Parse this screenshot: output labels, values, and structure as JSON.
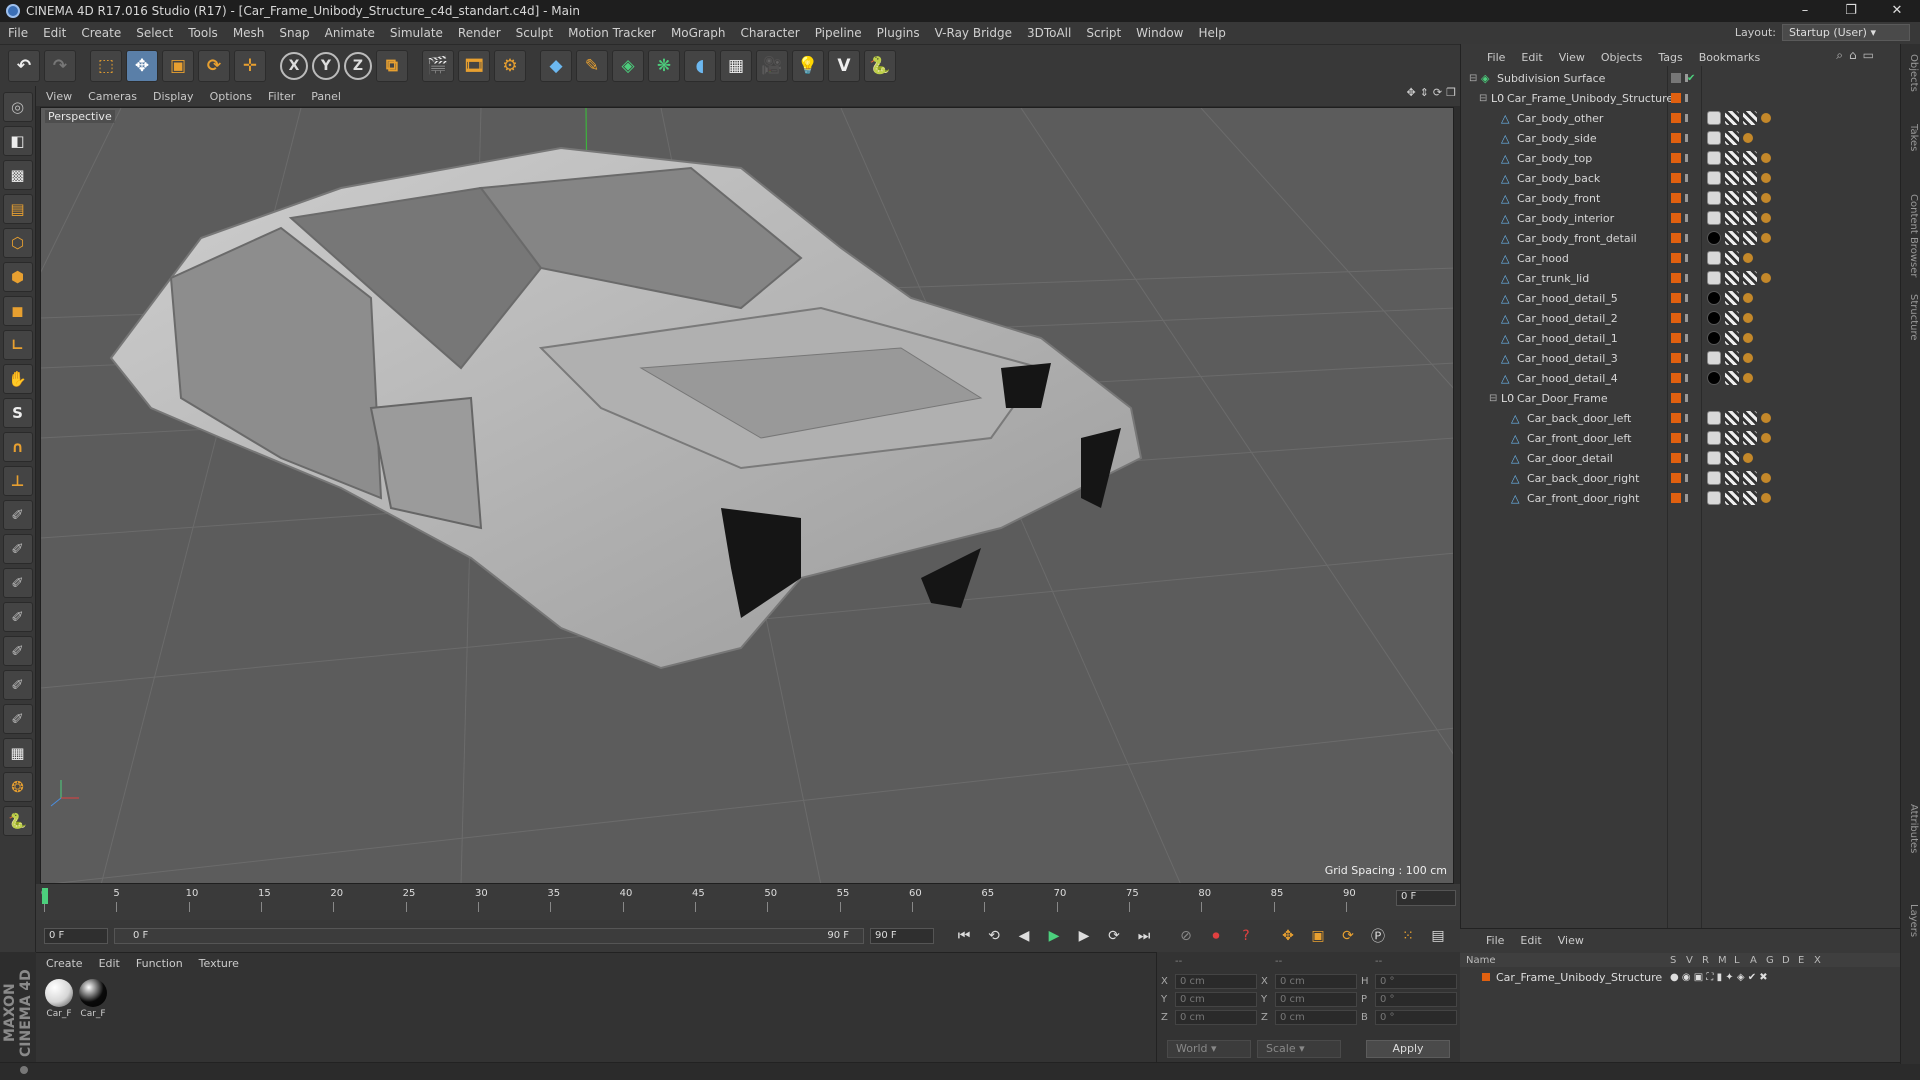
{
  "window": {
    "title": "CINEMA 4D R17.016 Studio (R17) - [Car_Frame_Unibody_Structure_c4d_standart.c4d] - Main",
    "controls": [
      "–",
      "❐",
      "✕"
    ]
  },
  "menubar": {
    "items": [
      "File",
      "Edit",
      "Create",
      "Select",
      "Tools",
      "Mesh",
      "Snap",
      "Animate",
      "Simulate",
      "Render",
      "Sculpt",
      "Motion Tracker",
      "MoGraph",
      "Character",
      "Pipeline",
      "Plugins",
      "V-Ray Bridge",
      "3DToAll",
      "Script",
      "Window",
      "Help"
    ],
    "layout_label": "Layout:",
    "layout_value": "Startup (User)"
  },
  "toolbar": {
    "axis_x": "X",
    "axis_y": "Y",
    "axis_z": "Z"
  },
  "viewport": {
    "menu": [
      "View",
      "Cameras",
      "Display",
      "Options",
      "Filter",
      "Panel"
    ],
    "label": "Perspective",
    "grid_spacing": "Grid Spacing : 100 cm",
    "colors": {
      "background": "#5c5c5c",
      "grid": "#6a6a6a",
      "model": "#b8b8b8"
    }
  },
  "timeline": {
    "ticks": [
      "0",
      "5",
      "10",
      "15",
      "20",
      "25",
      "30",
      "35",
      "40",
      "45",
      "50",
      "55",
      "60",
      "65",
      "70",
      "75",
      "80",
      "85",
      "90"
    ],
    "current_frame": "0 F"
  },
  "transport": {
    "start_field": "0 F",
    "slider_start": "0 F",
    "slider_end": "90 F",
    "end_field": "90 F"
  },
  "material_manager": {
    "menu": [
      "Create",
      "Edit",
      "Function",
      "Texture"
    ],
    "materials": [
      {
        "label": "Car_F",
        "color": "#d6d6d6"
      },
      {
        "label": "Car_F",
        "color": "#0a0a0a"
      }
    ]
  },
  "coordinates": {
    "headers": [
      "--",
      "--",
      "--"
    ],
    "rows": [
      {
        "a": "X",
        "v1": "0 cm",
        "b": "X",
        "v2": "0 cm",
        "c": "H",
        "v3": "0 °"
      },
      {
        "a": "Y",
        "v1": "0 cm",
        "b": "Y",
        "v2": "0 cm",
        "c": "P",
        "v3": "0 °"
      },
      {
        "a": "Z",
        "v1": "0 cm",
        "b": "Z",
        "v2": "0 cm",
        "c": "B",
        "v3": "0 °"
      }
    ],
    "world": "World",
    "scale": "Scale",
    "apply": "Apply"
  },
  "object_manager": {
    "menu": [
      "File",
      "Edit",
      "View",
      "Objects",
      "Tags",
      "Bookmarks"
    ],
    "objects": [
      {
        "name": "Subdivision Surface",
        "indent": 0,
        "icon": "subdiv-icon",
        "tags": []
      },
      {
        "name": "Car_Frame_Unibody_Structure",
        "indent": 1,
        "icon": "null-icon",
        "tags": []
      },
      {
        "name": "Car_body_other",
        "indent": 2,
        "icon": "poly-icon",
        "tags": [
          "phong",
          "check",
          "check",
          "ext"
        ]
      },
      {
        "name": "Car_body_side",
        "indent": 2,
        "icon": "poly-icon",
        "tags": [
          "phong",
          "check",
          "ext"
        ]
      },
      {
        "name": "Car_body_top",
        "indent": 2,
        "icon": "poly-icon",
        "tags": [
          "phong",
          "check",
          "check",
          "ext"
        ]
      },
      {
        "name": "Car_body_back",
        "indent": 2,
        "icon": "poly-icon",
        "tags": [
          "phong",
          "check",
          "check",
          "ext"
        ]
      },
      {
        "name": "Car_body_front",
        "indent": 2,
        "icon": "poly-icon",
        "tags": [
          "phong",
          "check",
          "check",
          "ext"
        ]
      },
      {
        "name": "Car_body_interior",
        "indent": 2,
        "icon": "poly-icon",
        "tags": [
          "phong",
          "check",
          "check",
          "ext"
        ]
      },
      {
        "name": "Car_body_front_detail",
        "indent": 2,
        "icon": "poly-icon",
        "tags": [
          "black",
          "check",
          "check",
          "ext"
        ]
      },
      {
        "name": "Car_hood",
        "indent": 2,
        "icon": "poly-icon",
        "tags": [
          "phong",
          "check",
          "ext"
        ]
      },
      {
        "name": "Car_trunk_lid",
        "indent": 2,
        "icon": "poly-icon",
        "tags": [
          "phong",
          "check",
          "check",
          "ext"
        ]
      },
      {
        "name": "Car_hood_detail_5",
        "indent": 2,
        "icon": "poly-icon",
        "tags": [
          "black",
          "check",
          "ext"
        ]
      },
      {
        "name": "Car_hood_detail_2",
        "indent": 2,
        "icon": "poly-icon",
        "tags": [
          "black",
          "check",
          "ext"
        ]
      },
      {
        "name": "Car_hood_detail_1",
        "indent": 2,
        "icon": "poly-icon",
        "tags": [
          "black",
          "check",
          "ext"
        ]
      },
      {
        "name": "Car_hood_detail_3",
        "indent": 2,
        "icon": "poly-icon",
        "tags": [
          "phong",
          "check",
          "ext"
        ]
      },
      {
        "name": "Car_hood_detail_4",
        "indent": 2,
        "icon": "poly-icon",
        "tags": [
          "black",
          "check",
          "ext"
        ]
      },
      {
        "name": "Car_Door_Frame",
        "indent": 2,
        "icon": "null-icon",
        "tags": []
      },
      {
        "name": "Car_back_door_left",
        "indent": 3,
        "icon": "poly-icon",
        "tags": [
          "phong",
          "check",
          "check",
          "ext"
        ]
      },
      {
        "name": "Car_front_door_left",
        "indent": 3,
        "icon": "poly-icon",
        "tags": [
          "phong",
          "check",
          "check",
          "ext"
        ]
      },
      {
        "name": "Car_door_detail",
        "indent": 3,
        "icon": "poly-icon",
        "tags": [
          "phong",
          "check",
          "ext"
        ]
      },
      {
        "name": "Car_back_door_right",
        "indent": 3,
        "icon": "poly-icon",
        "tags": [
          "phong",
          "check",
          "check",
          "ext"
        ]
      },
      {
        "name": "Car_front_door_right",
        "indent": 3,
        "icon": "poly-icon",
        "tags": [
          "phong",
          "check",
          "check",
          "ext"
        ]
      }
    ]
  },
  "right_tabs": [
    "Objects",
    "Takes",
    "Content Browser",
    "Structure",
    "Attributes",
    "Layers"
  ],
  "layer_manager": {
    "menu": [
      "File",
      "Edit",
      "View"
    ],
    "columns": [
      "Name",
      "S",
      "V",
      "R",
      "M",
      "L",
      "A",
      "G",
      "D",
      "E",
      "X"
    ],
    "row_name": "Car_Frame_Unibody_Structure"
  },
  "brand": "MAXON CINEMA 4D"
}
